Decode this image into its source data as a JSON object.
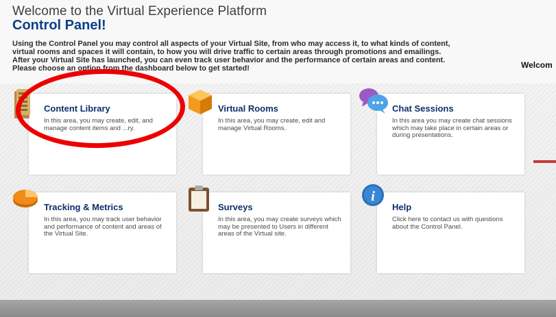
{
  "header": {
    "welcome": "Welcome to the Virtual Experience Platform",
    "title": "Control Panel!",
    "intro_lines": [
      "Using the Control Panel you may control all aspects of your Virtual Site, from who may access it, to what kinds of content,",
      "virtual rooms and spaces it will contain, to how you will drive traffic to certain areas through promotions and emailings.",
      "After your Virtual Site has launched, you can even track user behavior and the performance of certain areas and content.",
      "Please choose an option from the dashboard below to get started!"
    ],
    "right_label": "Welcom"
  },
  "cards": [
    {
      "title": "Content Library",
      "desc": "In this area, you may create, edit, and manage content items and ...ry.",
      "icon": "books-icon",
      "color": "#c9a25a"
    },
    {
      "title": "Virtual Rooms",
      "desc": "In this area, you may create, edit and manage Virtual Rooms.",
      "icon": "cube-icon",
      "color": "#f29a1c"
    },
    {
      "title": "Chat Sessions",
      "desc": "In this area you may create chat sessions which may take place in certain areas or during presentations.",
      "icon": "chat-bubbles-icon",
      "color": "#5aa9e6"
    },
    {
      "title": "Tracking & Metrics",
      "desc": "In this area, you may track user behavior and performance of content and areas of the Virtual Site.",
      "icon": "pie-chart-icon",
      "color": "#f08a18"
    },
    {
      "title": "Surveys",
      "desc": "In this area, you may create surveys which may be presented to Users in different areas of the Virtual site.",
      "icon": "clipboard-icon",
      "color": "#7a5230"
    },
    {
      "title": "Help",
      "desc": "Click here to contact us with questions about the Control Panel.",
      "icon": "info-icon",
      "color": "#2d6fb6"
    }
  ],
  "annotation": {
    "color": "#ec0000"
  }
}
